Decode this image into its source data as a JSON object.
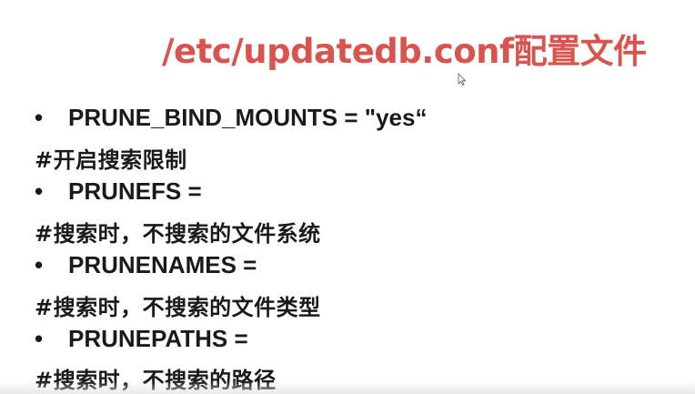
{
  "slide": {
    "title": "/etc/updatedb.conf配置文件",
    "title_color": "#d9534f",
    "bullet_symbol": "•",
    "items": [
      {
        "setting": "PRUNE_BIND_MOUNTS = \"yes“",
        "comment": "#开启搜索限制"
      },
      {
        "setting": "PRUNEFS =",
        "comment": "#搜索时，不搜索的文件系统"
      },
      {
        "setting": "PRUNENAMES =",
        "comment": "#搜索时，不搜索的文件类型"
      },
      {
        "setting": "PRUNEPATHS =",
        "comment": "#搜索时，不搜索的路径"
      }
    ]
  }
}
